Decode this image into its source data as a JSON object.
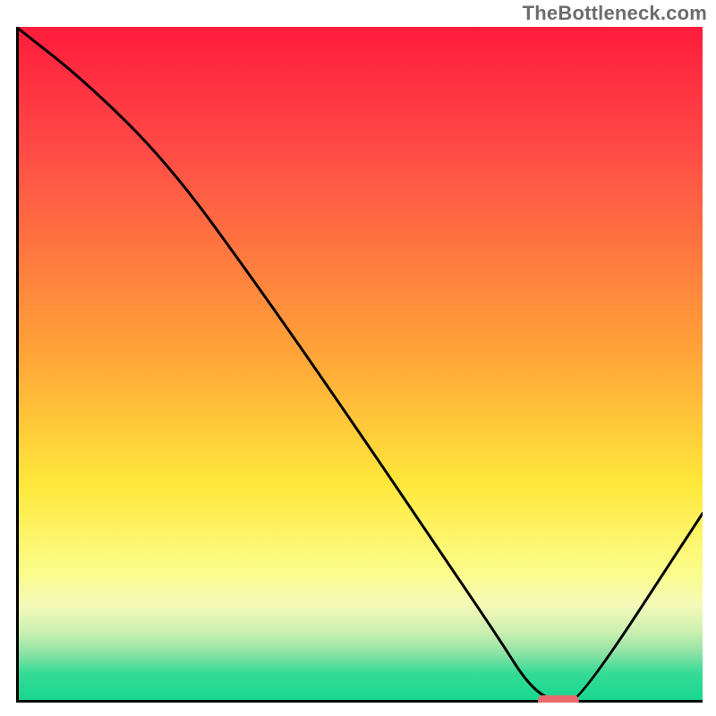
{
  "watermark": "TheBottleneck.com",
  "colors": {
    "curve_stroke": "#000000",
    "axis_stroke": "#000000",
    "marker": "#e86a6e"
  },
  "chart_data": {
    "type": "line",
    "title": "",
    "xlabel": "",
    "ylabel": "",
    "xlim": [
      0,
      100
    ],
    "ylim": [
      0,
      100
    ],
    "grid": false,
    "legend": false,
    "x": [
      0,
      10,
      22,
      35,
      50,
      62,
      70,
      75,
      79,
      82,
      100
    ],
    "values": [
      100,
      92,
      80,
      62,
      40,
      22,
      10,
      2,
      0,
      0,
      28
    ],
    "marker": {
      "x_range": [
        76,
        82
      ],
      "y": 0.3
    },
    "background_gradient": "red-to-green vertical"
  }
}
